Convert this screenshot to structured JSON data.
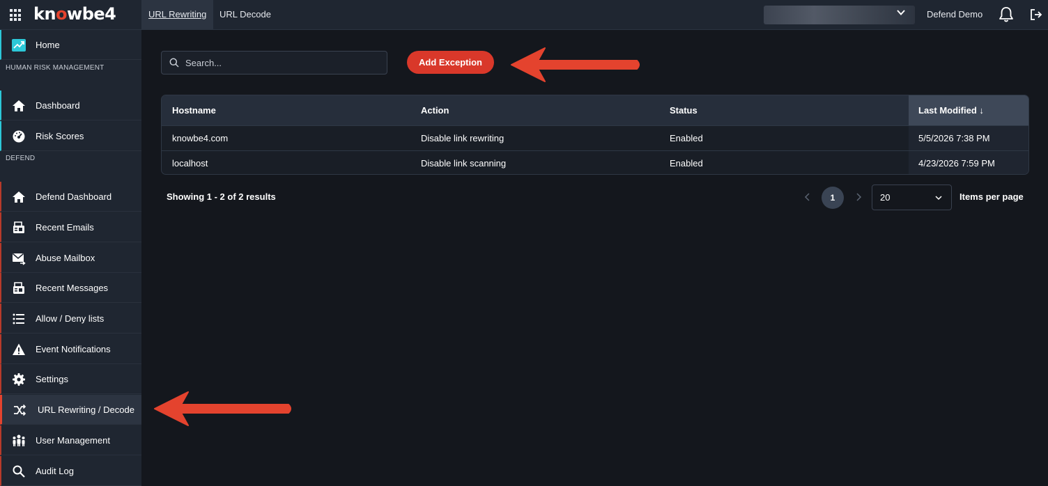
{
  "header": {
    "logo_text_a": "kn",
    "logo_text_b": "o",
    "logo_text_c": "wbe4",
    "tabs": [
      {
        "label": "URL Rewriting",
        "active": true
      },
      {
        "label": "URL Decode",
        "active": false
      }
    ],
    "user_name": "Defend Demo",
    "icons": [
      "apps-grid-icon",
      "chevron-down-icon",
      "bell-icon",
      "logout-icon"
    ]
  },
  "sidebar": {
    "top_item": {
      "label": "Home",
      "icon": "trend-chart-icon"
    },
    "sections": [
      {
        "label": "HUMAN RISK MANAGEMENT",
        "items": [
          {
            "label": "Dashboard",
            "icon": "home-icon"
          },
          {
            "label": "Risk Scores",
            "icon": "gauge-icon"
          }
        ]
      },
      {
        "label": "DEFEND",
        "items": [
          {
            "label": "Defend Dashboard",
            "icon": "home-icon"
          },
          {
            "label": "Recent Emails",
            "icon": "mail-list-icon"
          },
          {
            "label": "Abuse Mailbox",
            "icon": "mail-forward-icon"
          },
          {
            "label": "Recent Messages",
            "icon": "message-list-icon"
          },
          {
            "label": "Allow / Deny lists",
            "icon": "list-icon"
          },
          {
            "label": "Event Notifications",
            "icon": "warning-icon"
          },
          {
            "label": "Settings",
            "icon": "gear-icon"
          },
          {
            "label": "URL Rewriting / Decode",
            "icon": "shuffle-icon",
            "active": true
          },
          {
            "label": "User Management",
            "icon": "users-icon"
          },
          {
            "label": "Audit Log",
            "icon": "search-icon"
          }
        ]
      }
    ]
  },
  "toolbar": {
    "search_placeholder": "Search...",
    "add_label": "Add Exception"
  },
  "table": {
    "columns": [
      "Hostname",
      "Action",
      "Status",
      "Last Modified"
    ],
    "sort_column": "Last Modified",
    "sort_direction": "descending",
    "sort_glyph": "↓",
    "rows": [
      {
        "hostname": "knowbe4.com",
        "action": "Disable link rewriting",
        "status": "Enabled",
        "modified": "5/5/2026 7:38 PM"
      },
      {
        "hostname": "localhost",
        "action": "Disable link scanning",
        "status": "Enabled",
        "modified": "4/23/2026 7:59 PM"
      }
    ]
  },
  "pagination": {
    "summary": "Showing 1 - 2 of 2 results",
    "current_page": "1",
    "per_page": "20",
    "per_page_label": "Items per page"
  },
  "colors": {
    "background": "#14171d",
    "panel": "#1f2631",
    "accent_red": "#d9382a",
    "teal_accent": "#2cc8d8"
  }
}
